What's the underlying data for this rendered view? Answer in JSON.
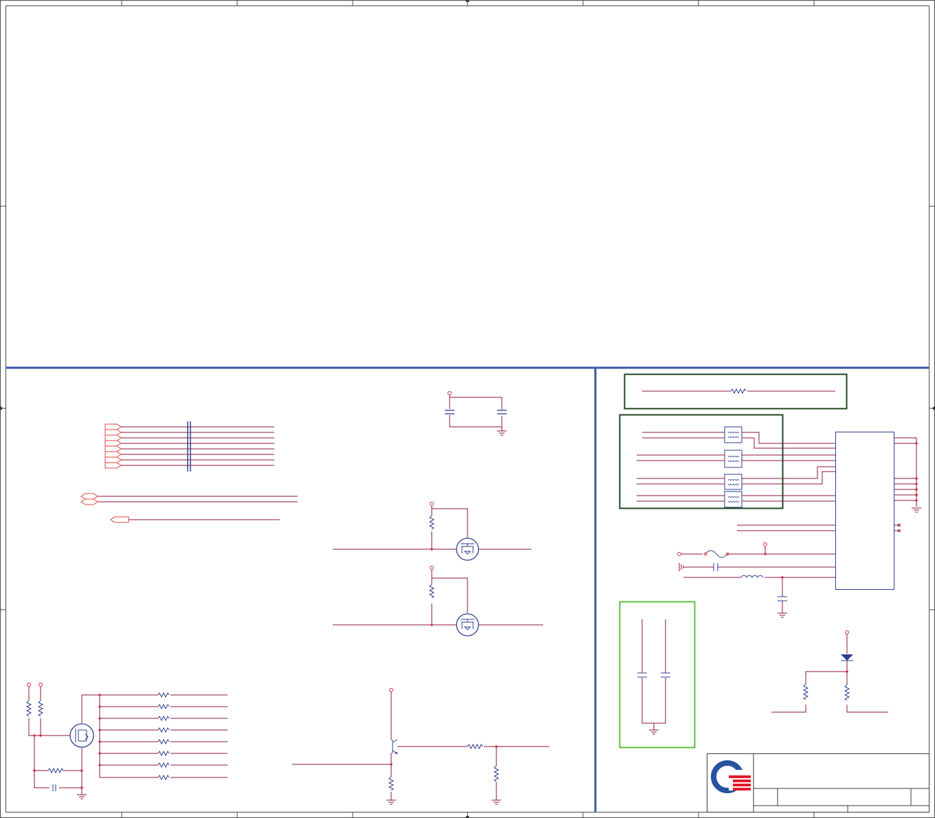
{
  "sheet": {
    "background": "#ffffff",
    "border_color": "#4a4a4a",
    "divider_color": "#3a56a6",
    "wire_color": "#8b1538",
    "component_color": "#2d3d8f",
    "net_port_color": "#e0443c",
    "power_pin_color": "#d0303a",
    "ground_color": "#8b1538"
  },
  "frames": {
    "upper_box_color": "#1e4620",
    "lower_box_color": "#1e4620",
    "decoupling_box_color": "#5cbf3c"
  },
  "logo": {
    "name": "company-logo",
    "ring_color": "#2553a0",
    "stripe_color": "#e11b2c"
  },
  "title_block": {
    "title": "",
    "doc_number": "",
    "rev": "",
    "sheet_info": ""
  }
}
